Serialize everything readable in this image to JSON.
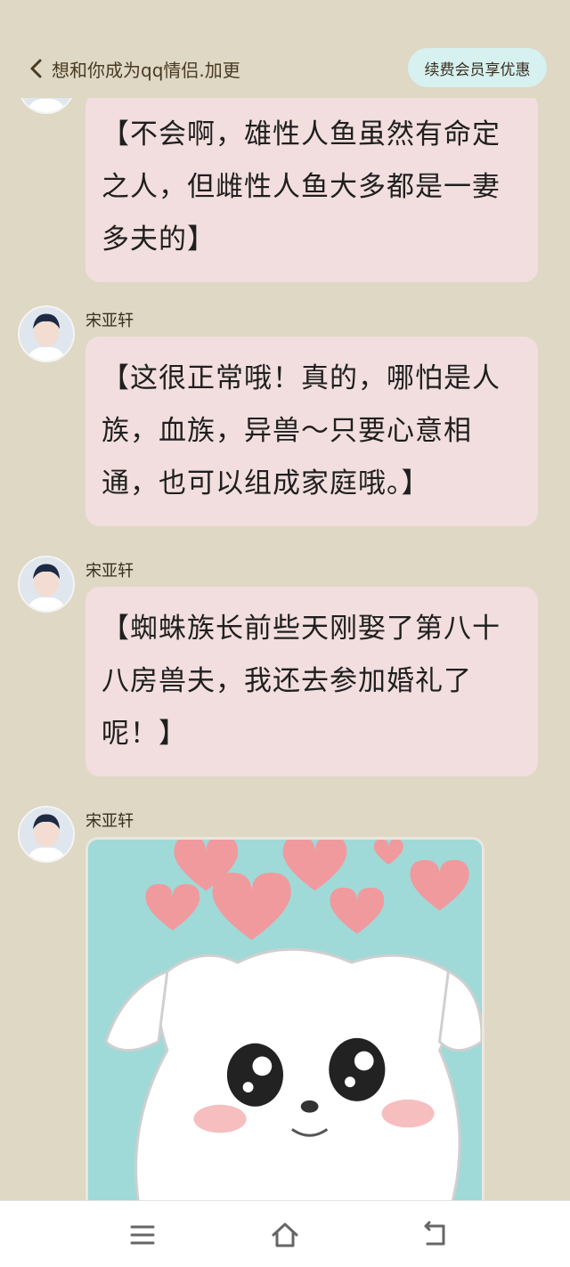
{
  "header": {
    "title": "想和你成为qq情侣.加更",
    "vip_label": "续费会员享优惠"
  },
  "messages": [
    {
      "sender": "",
      "text": "【不会啊，雄性人鱼虽然有命定之人，但雌性人鱼大多都是一妻多夫的】"
    },
    {
      "sender": "宋亚轩",
      "text": "【这很正常哦！真的，哪怕是人族，血族，异兽～只要心意相通，也可以组成家庭哦。】"
    },
    {
      "sender": "宋亚轩",
      "text": "【蜘蛛族长前些天刚娶了第八十八房兽夫，我还去参加婚礼了呢！】"
    },
    {
      "sender": "宋亚轩",
      "sticker": "cute-dog-hearts-sticker"
    }
  ],
  "navbar": {
    "menu_icon": "menu-icon",
    "home_icon": "home-icon",
    "back_icon": "back-icon"
  },
  "colors": {
    "background": "#ded8c4",
    "bubble": "#f2dede",
    "vip_button": "#d6f1f0",
    "sticker_bg": "#9fdad8",
    "heart": "#f09a9e"
  }
}
